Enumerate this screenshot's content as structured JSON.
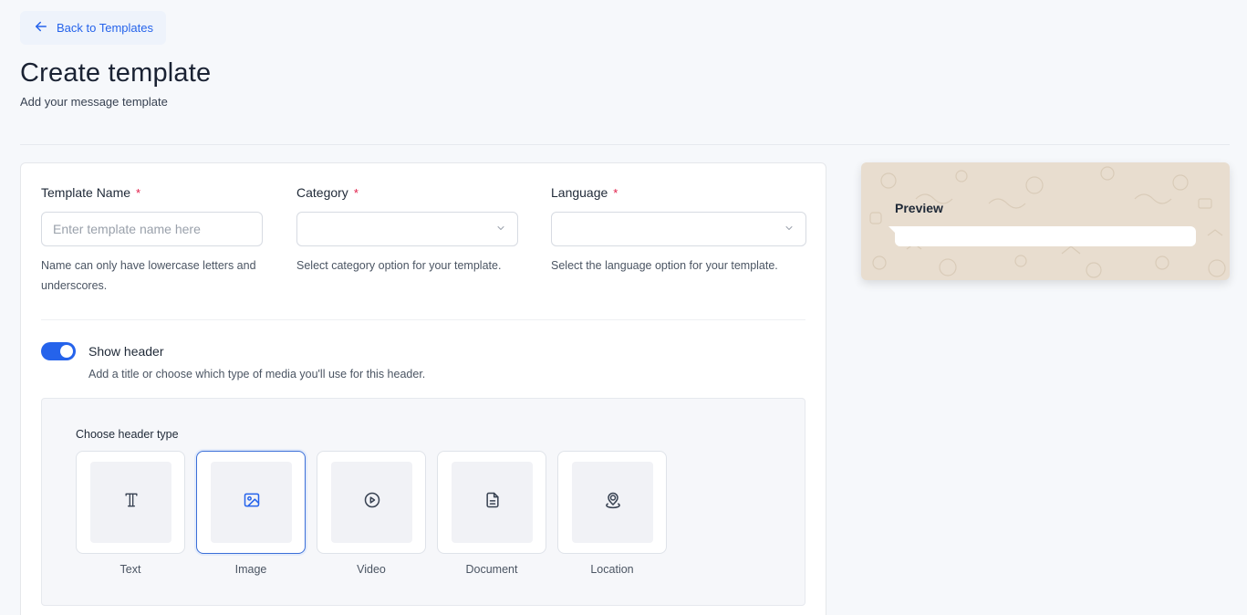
{
  "back_button": {
    "label": "Back to Templates"
  },
  "page": {
    "title": "Create template",
    "subtitle": "Add your message template"
  },
  "form": {
    "template_name": {
      "label": "Template Name",
      "required_mark": "*",
      "placeholder": "Enter template name here",
      "value": "",
      "help": "Name can only have lowercase letters and underscores."
    },
    "category": {
      "label": "Category",
      "required_mark": "*",
      "value": "",
      "help": "Select category option for your template."
    },
    "language": {
      "label": "Language",
      "required_mark": "*",
      "value": "",
      "help": "Select the language option for your template."
    }
  },
  "header_section": {
    "toggle_on": true,
    "toggle_label": "Show header",
    "toggle_help": "Add a title or choose which type of media you'll use for this header.",
    "choose_label": "Choose header type",
    "selected": "Image",
    "types": [
      {
        "label": "Text",
        "icon": "text-icon"
      },
      {
        "label": "Image",
        "icon": "image-icon"
      },
      {
        "label": "Video",
        "icon": "play-icon"
      },
      {
        "label": "Document",
        "icon": "document-icon"
      },
      {
        "label": "Location",
        "icon": "location-pin-icon"
      }
    ]
  },
  "preview": {
    "title": "Preview"
  },
  "colors": {
    "accent": "#2563eb",
    "required": "#e11d48",
    "page_bg": "#f6f8fb",
    "preview_bg": "#e8ddcf"
  }
}
